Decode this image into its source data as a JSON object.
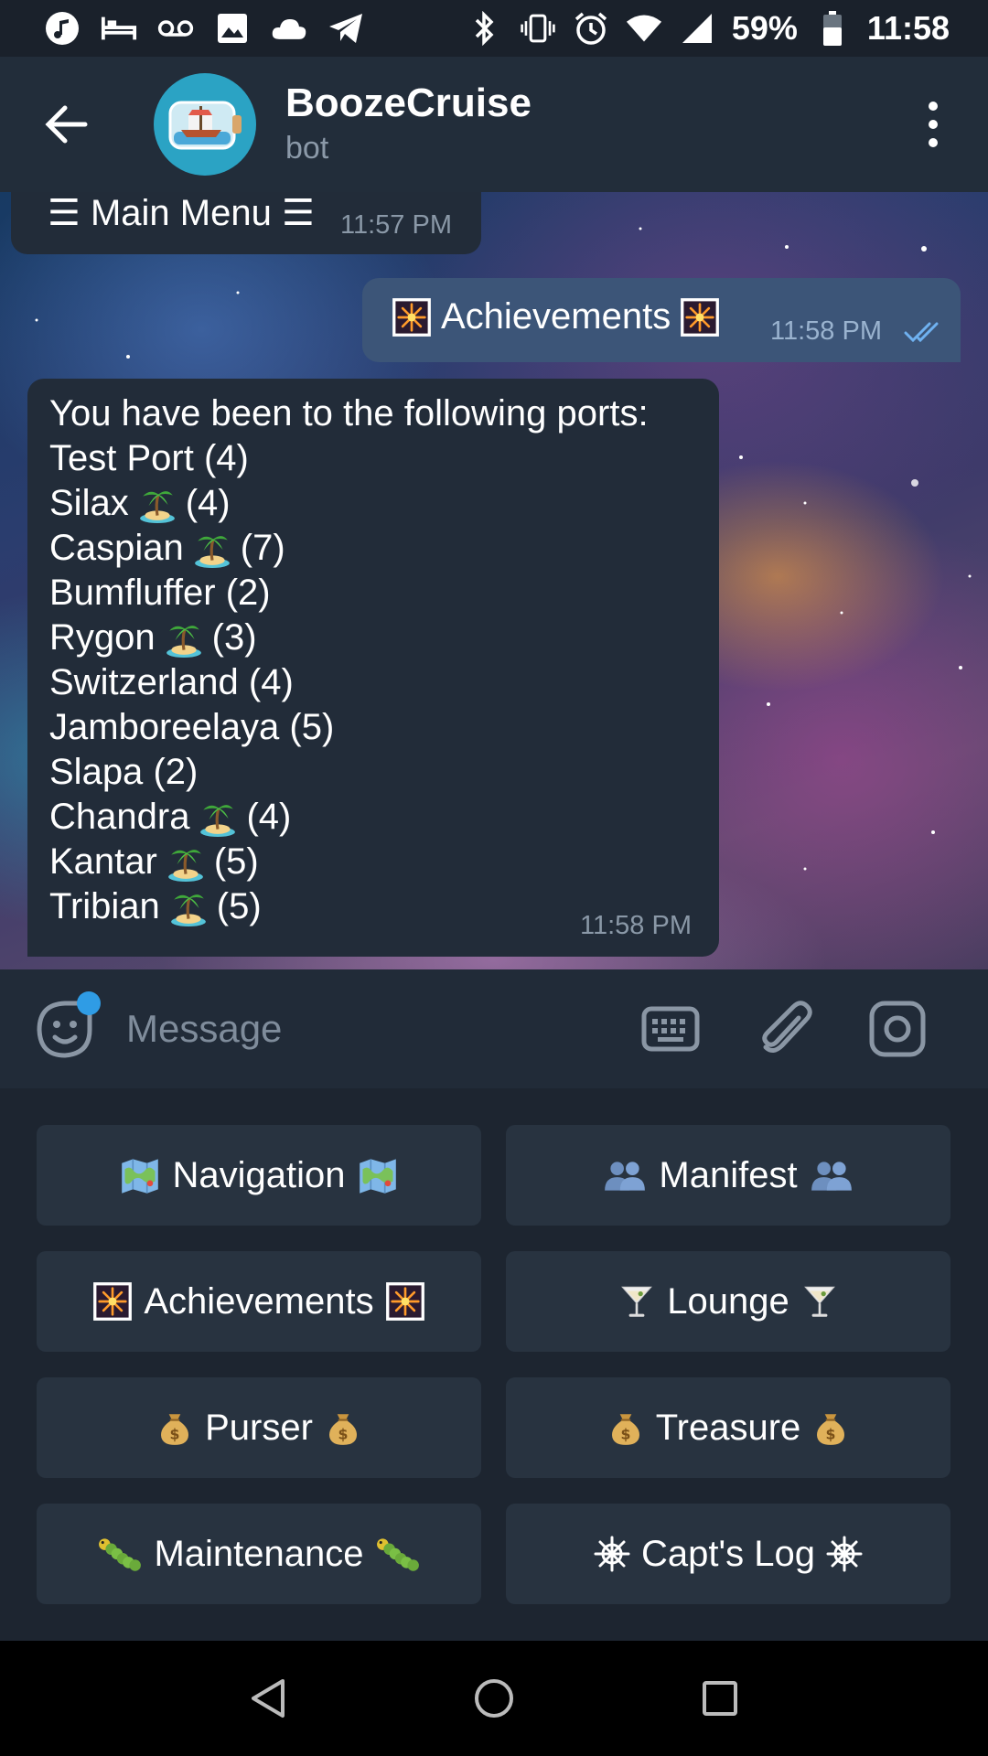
{
  "status_bar": {
    "battery": "59%",
    "time": "11:58",
    "left_icons": [
      "music-note-icon",
      "bed-icon",
      "voicemail-icon",
      "image-icon",
      "cloud-icon",
      "telegram-icon"
    ],
    "right_icons": [
      "bluetooth-icon",
      "vibrate-icon",
      "alarm-icon",
      "wifi-icon",
      "signal-icon",
      "battery-icon"
    ]
  },
  "header": {
    "title": "BoozeCruise",
    "subtitle": "bot"
  },
  "messages": {
    "menu": {
      "text": "☰ Main Menu ☰",
      "time": "11:57 PM"
    },
    "achievements": {
      "text": "Achievements",
      "time": "11:58 PM"
    },
    "ports": {
      "intro": "You have been to the following ports:",
      "time": "11:58 PM",
      "list": [
        {
          "name": "Test Port",
          "palm": false,
          "count": "(4)"
        },
        {
          "name": "Silax",
          "palm": true,
          "count": "(4)"
        },
        {
          "name": "Caspian",
          "palm": true,
          "count": "(7)"
        },
        {
          "name": "Bumfluffer",
          "palm": false,
          "count": "(2)"
        },
        {
          "name": "Rygon",
          "palm": true,
          "count": "(3)"
        },
        {
          "name": "Switzerland",
          "palm": false,
          "count": "(4)"
        },
        {
          "name": "Jamboreelaya",
          "palm": false,
          "count": "(5)"
        },
        {
          "name": "Slapa",
          "palm": false,
          "count": "(2)"
        },
        {
          "name": "Chandra",
          "palm": true,
          "count": "(4)"
        },
        {
          "name": "Kantar",
          "palm": true,
          "count": "(5)"
        },
        {
          "name": "Tribian",
          "palm": true,
          "count": "(5)"
        }
      ]
    }
  },
  "input": {
    "placeholder": "Message"
  },
  "keyboard": {
    "navigation": "Navigation",
    "manifest": "Manifest",
    "achievements": "Achievements",
    "lounge": "Lounge",
    "purser": "Purser",
    "treasure": "Treasure",
    "maintenance": "Maintenance",
    "capts_log": "Capt's Log"
  },
  "colors": {
    "header_bg": "#222d3a",
    "bubble_in": "#222c39",
    "bubble_out": "#3c5578",
    "keyboard_bg": "#1d2530",
    "button_bg": "#283340",
    "accent": "#2f9ce5"
  }
}
